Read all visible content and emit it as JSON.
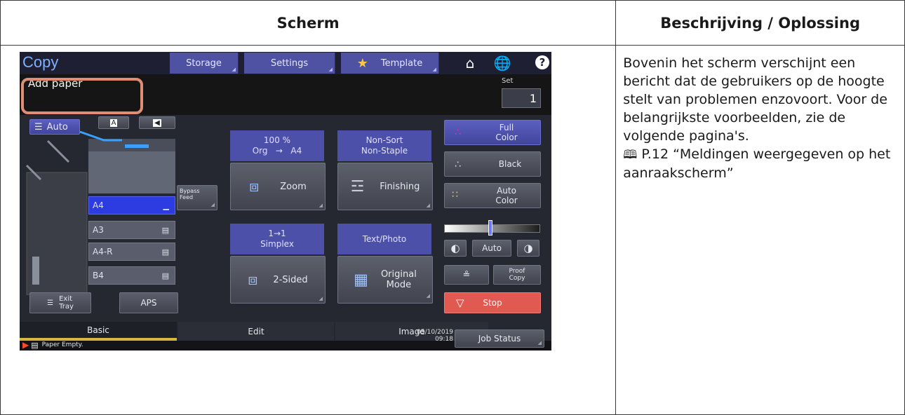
{
  "table": {
    "col_screen": "Scherm",
    "col_desc": "Beschrijving / Oplossing",
    "description": "Bovenin het scherm verschijnt een bericht dat de gebruikers op de hoogte stelt van problemen enzovoort. Voor de belangrijkste voorbeelden, zie de volgende pagina's.",
    "reference": "P.12 “Meldingen weergegeven op het aanraakscherm”",
    "reference_icon": "book-icon"
  },
  "panel": {
    "title": "Copy",
    "top_buttons": {
      "storage": "Storage",
      "settings": "Settings",
      "template": "Template"
    },
    "message": "Add paper",
    "set_label": "Set",
    "set_value": "1",
    "paper_auto": "Auto",
    "orientation_a": "A",
    "bypass": "Bypass\nFeed",
    "trays": [
      "A4",
      "A3",
      "A4-R",
      "B4"
    ],
    "exit_tray": "Exit\nTray",
    "aps": "APS",
    "zoom_info": "100 %\nOrg   →   A4",
    "zoom": "Zoom",
    "finishing_info": "Non-Sort\nNon-Staple",
    "finishing": "Finishing",
    "duplex_info": "1→1\nSimplex",
    "two_sided": "2-Sided",
    "mode_info": "Text/Photo",
    "original_mode": "Original\nMode",
    "full_color": "Full\nColor",
    "black": "Black",
    "auto_color": "Auto\nColor",
    "density_auto": "Auto",
    "proof_copy": "Proof\nCopy",
    "stop": "Stop",
    "tabs": [
      "Basic",
      "Edit",
      "Image"
    ],
    "status_message": "Paper Empty.",
    "date": "05/10/2019",
    "time": "09:18",
    "job_status": "Job Status",
    "colors": {
      "top_blue": "#4f51a3",
      "highlight": "#e08e73",
      "stop_red": "#e05a52",
      "tab_accent": "#d7b740"
    }
  }
}
